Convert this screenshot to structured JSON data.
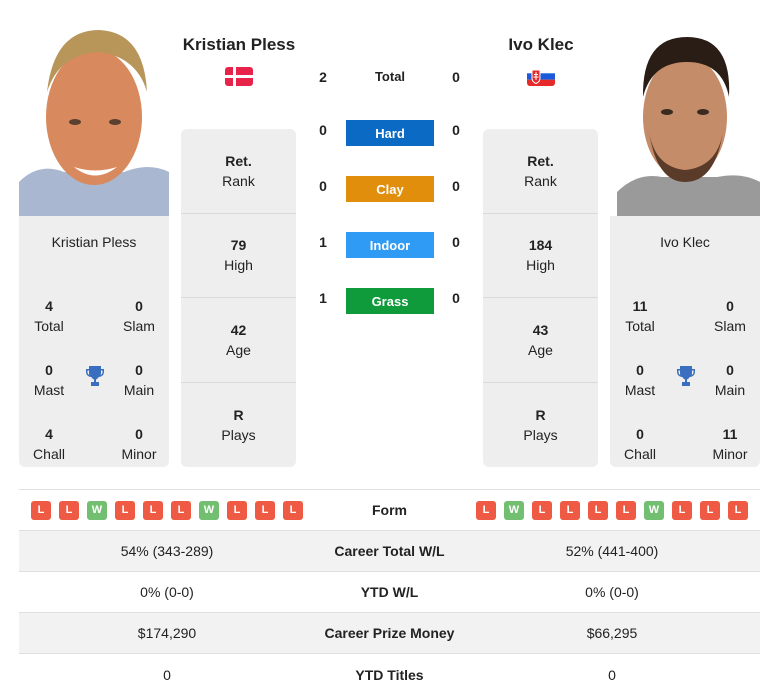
{
  "player_left": {
    "name": "Kristian Pless",
    "country": "Denmark",
    "flag_icon": "denmark-flag-icon",
    "info": [
      {
        "value": "Ret.",
        "label": "Rank"
      },
      {
        "value": "79",
        "label": "High"
      },
      {
        "value": "42",
        "label": "Age"
      },
      {
        "value": "R",
        "label": "Plays"
      }
    ],
    "titles": {
      "total": {
        "value": "4",
        "label": "Total"
      },
      "slam": {
        "value": "0",
        "label": "Slam"
      },
      "mast": {
        "value": "0",
        "label": "Mast"
      },
      "main": {
        "value": "0",
        "label": "Main"
      },
      "chall": {
        "value": "4",
        "label": "Chall"
      },
      "minor": {
        "value": "0",
        "label": "Minor"
      }
    },
    "form": [
      "L",
      "L",
      "W",
      "L",
      "L",
      "L",
      "W",
      "L",
      "L",
      "L"
    ]
  },
  "player_right": {
    "name": "Ivo Klec",
    "country": "Slovakia",
    "flag_icon": "slovakia-flag-icon",
    "info": [
      {
        "value": "Ret.",
        "label": "Rank"
      },
      {
        "value": "184",
        "label": "High"
      },
      {
        "value": "43",
        "label": "Age"
      },
      {
        "value": "R",
        "label": "Plays"
      }
    ],
    "titles": {
      "total": {
        "value": "11",
        "label": "Total"
      },
      "slam": {
        "value": "0",
        "label": "Slam"
      },
      "mast": {
        "value": "0",
        "label": "Mast"
      },
      "main": {
        "value": "0",
        "label": "Main"
      },
      "chall": {
        "value": "0",
        "label": "Chall"
      },
      "minor": {
        "value": "11",
        "label": "Minor"
      }
    },
    "form": [
      "L",
      "W",
      "L",
      "L",
      "L",
      "L",
      "W",
      "L",
      "L",
      "L"
    ]
  },
  "h2h": {
    "total": {
      "label": "Total",
      "left": "2",
      "right": "0"
    },
    "surfaces": [
      {
        "label": "Hard",
        "left": "0",
        "right": "0",
        "color": "#0a6ac4"
      },
      {
        "label": "Clay",
        "left": "0",
        "right": "0",
        "color": "#e08e0b"
      },
      {
        "label": "Indoor",
        "left": "1",
        "right": "0",
        "color": "#2f9bf5"
      },
      {
        "label": "Grass",
        "left": "1",
        "right": "0",
        "color": "#0f9a3c"
      }
    ]
  },
  "stats": {
    "form_label": "Form",
    "rows": [
      {
        "label": "Career Total W/L",
        "left": "54% (343-289)",
        "right": "52% (441-400)"
      },
      {
        "label": "YTD W/L",
        "left": "0% (0-0)",
        "right": "0% (0-0)"
      },
      {
        "label": "Career Prize Money",
        "left": "$174,290",
        "right": "$66,295"
      },
      {
        "label": "YTD Titles",
        "left": "0",
        "right": "0"
      }
    ]
  },
  "colors": {
    "win": "#72bf72",
    "loss": "#ef5a45",
    "trophy": "#3a6fbf"
  }
}
